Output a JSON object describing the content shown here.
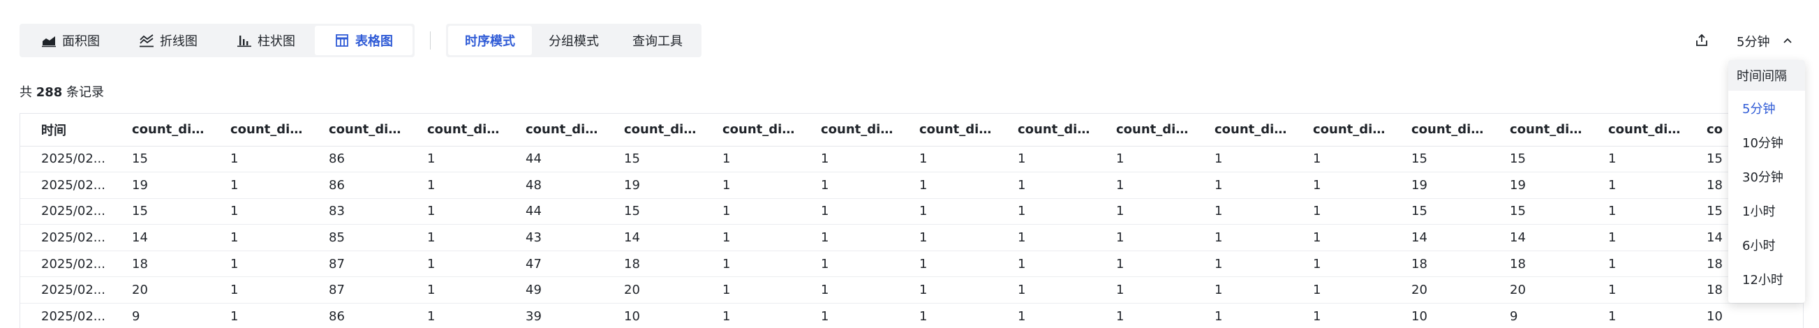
{
  "chart_types": [
    {
      "label": "面积图",
      "icon": "area-chart-icon",
      "active": false
    },
    {
      "label": "折线图",
      "icon": "line-chart-icon",
      "active": false
    },
    {
      "label": "柱状图",
      "icon": "bar-chart-icon",
      "active": false
    },
    {
      "label": "表格图",
      "icon": "table-icon",
      "active": true
    }
  ],
  "modes": [
    {
      "label": "时序模式",
      "active": true
    },
    {
      "label": "分组模式",
      "active": false
    },
    {
      "label": "查询工具",
      "active": false
    }
  ],
  "interval": {
    "current": "5分钟"
  },
  "records": {
    "prefix": "共 ",
    "count": "288",
    "suffix": " 条记录"
  },
  "table": {
    "columns": [
      "时间",
      "count_dis...",
      "count_dis...",
      "count_dis...",
      "count_dis...",
      "count_dis...",
      "count_dis...",
      "count_dis...",
      "count_dis...",
      "count_dis...",
      "count_dis...",
      "count_dis...",
      "count_dis...",
      "count_dis...",
      "count_dis...",
      "count_dis...",
      "count_dis...",
      "co"
    ],
    "rows": [
      [
        "2025/02...",
        "15",
        "1",
        "86",
        "1",
        "44",
        "15",
        "1",
        "1",
        "1",
        "1",
        "1",
        "1",
        "1",
        "15",
        "15",
        "1",
        "15"
      ],
      [
        "2025/02...",
        "19",
        "1",
        "86",
        "1",
        "48",
        "19",
        "1",
        "1",
        "1",
        "1",
        "1",
        "1",
        "1",
        "19",
        "19",
        "1",
        "18"
      ],
      [
        "2025/02...",
        "15",
        "1",
        "83",
        "1",
        "44",
        "15",
        "1",
        "1",
        "1",
        "1",
        "1",
        "1",
        "1",
        "15",
        "15",
        "1",
        "15"
      ],
      [
        "2025/02...",
        "14",
        "1",
        "85",
        "1",
        "43",
        "14",
        "1",
        "1",
        "1",
        "1",
        "1",
        "1",
        "1",
        "14",
        "14",
        "1",
        "14"
      ],
      [
        "2025/02...",
        "18",
        "1",
        "87",
        "1",
        "47",
        "18",
        "1",
        "1",
        "1",
        "1",
        "1",
        "1",
        "1",
        "18",
        "18",
        "1",
        "18"
      ],
      [
        "2025/02...",
        "20",
        "1",
        "87",
        "1",
        "49",
        "20",
        "1",
        "1",
        "1",
        "1",
        "1",
        "1",
        "1",
        "20",
        "20",
        "1",
        "18"
      ],
      [
        "2025/02...",
        "9",
        "1",
        "86",
        "1",
        "39",
        "10",
        "1",
        "1",
        "1",
        "1",
        "1",
        "1",
        "1",
        "10",
        "9",
        "1",
        "10"
      ]
    ]
  },
  "dropdown": {
    "title": "时间间隔",
    "options": [
      "5分钟",
      "10分钟",
      "30分钟",
      "1小时",
      "6小时",
      "12小时"
    ],
    "selected": "5分钟"
  },
  "colors": {
    "accent": "#2f5bd6",
    "segment_bg": "#f2f3f5",
    "border": "#e5e6eb"
  }
}
